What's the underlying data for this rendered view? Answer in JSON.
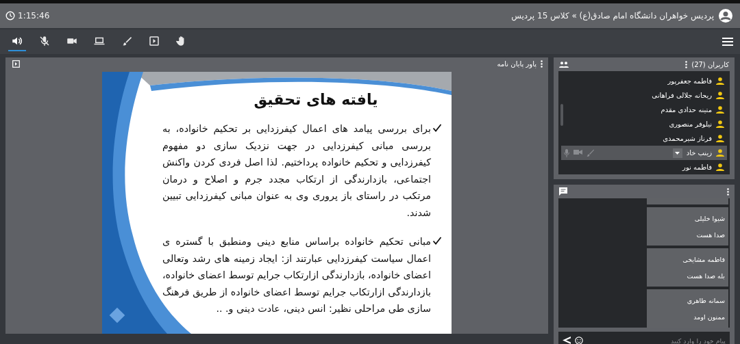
{
  "header": {
    "time": "1:15:46",
    "title": "پردیس خواهران دانشگاه امام صادق(ع) » کلاس 15 پردیس"
  },
  "toolbar": [
    {
      "kind": "speaker",
      "selected": true
    },
    {
      "kind": "mic-off",
      "selected": false
    },
    {
      "kind": "camera",
      "selected": false
    },
    {
      "kind": "laptop",
      "selected": false
    },
    {
      "kind": "brush",
      "selected": false
    },
    {
      "kind": "play",
      "selected": false
    },
    {
      "kind": "hand",
      "selected": false
    }
  ],
  "presentation": {
    "title": "پاور پایان نامه",
    "slide": {
      "heading": "یافته های تحقیق",
      "bullets": [
        "برای بررسی پیامد های اعمال کیفرزدایی بر تحکیم خانواده، به بررسی مبانی کیفرزدایی در جهت نزدیک سازی دو مفهوم کیفرزدایی و تحکیم خانواده پرداختیم. لذا اصل فردی کردن واکنش اجتماعی، بازدارندگی از ارتکاب مجدد جرم و اصلاح و درمان مرتکب در راستای باز پروری وی به عنوان مبانی کیفرزدایی تبیین شدند.",
        "مبانی تحکیم خانواده براساس منابع دینی ومنطبق با گستره ی اعمال سیاست کیفرزدایی عبارتند از: ایجاد زمینه های رشد وتعالی اعضای خانواده، بازدارندگی ازارتکاب جرایم توسط اعضای خانواده، بازدارندگی ازارتکاب جرایم توسط اعضای خانواده از طریق فرهنگ سازی طی مراحلی نظیر: انس دینی، عادت دینی و. .."
      ]
    }
  },
  "users": {
    "title": "کاربران (27)",
    "items": [
      {
        "name": "فاطمه جعفرپور",
        "selected": false
      },
      {
        "name": "ریحانه جلالی فراهانی",
        "selected": false
      },
      {
        "name": "متینه حدادی مقدم",
        "selected": false
      },
      {
        "name": "نیلوفر منصوری",
        "selected": false
      },
      {
        "name": "فرناز شیرمحمدی",
        "selected": false
      },
      {
        "name": "زینب خاد",
        "selected": true
      },
      {
        "name": "فاطمه نور",
        "selected": false
      }
    ]
  },
  "chat": {
    "messages": [
      {
        "sender": "شیوا خلیلی",
        "text": "صدا هست"
      },
      {
        "sender": "فاطمه مشایخی",
        "text": "بله صدا هست"
      },
      {
        "sender": "سمانه طاهری",
        "text": "ممنون  اومد"
      }
    ],
    "input": {
      "placeholder": "پیام خود را وارد کنید"
    }
  }
}
